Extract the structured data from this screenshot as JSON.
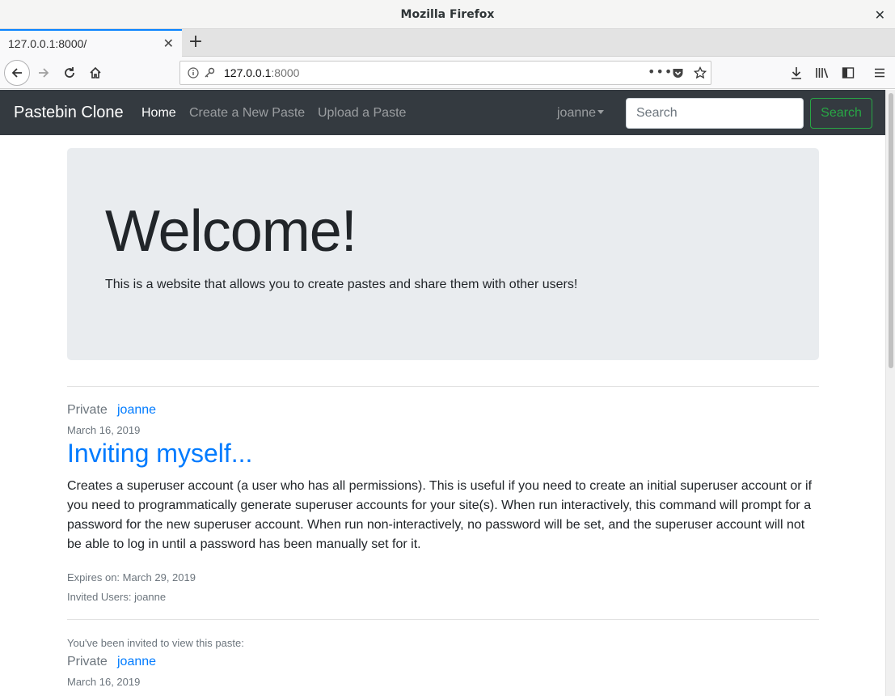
{
  "browser": {
    "window_title": "Mozilla Firefox",
    "tab_title": "127.0.0.1:8000/",
    "url_host": "127.0.0.1",
    "url_port": ":8000"
  },
  "site": {
    "brand": "Pastebin Clone",
    "nav": {
      "home": "Home",
      "create": "Create a New Paste",
      "upload": "Upload a Paste",
      "user": "joanne"
    },
    "search": {
      "placeholder": "Search",
      "button": "Search"
    }
  },
  "jumbotron": {
    "heading": "Welcome!",
    "lead": "This is a website that allows you to create pastes and share them with other users!"
  },
  "pastes": [
    {
      "privacy": "Private",
      "author": "joanne",
      "date": "March 16, 2019",
      "title": "Inviting myself...",
      "body": "Creates a superuser account (a user who has all permissions). This is useful if you need to create an initial superuser account or if you need to programmatically generate superuser accounts for your site(s). When run interactively, this command will prompt for a password for the new superuser account. When run non-interactively, no password will be set, and the superuser account will not be able to log in until a password has been manually set for it.",
      "expires": "Expires on: March 29, 2019",
      "invited": "Invited Users: joanne"
    },
    {
      "invite_note": "You've been invited to view this paste:",
      "privacy": "Private",
      "author": "joanne",
      "date": "March 16, 2019"
    }
  ]
}
